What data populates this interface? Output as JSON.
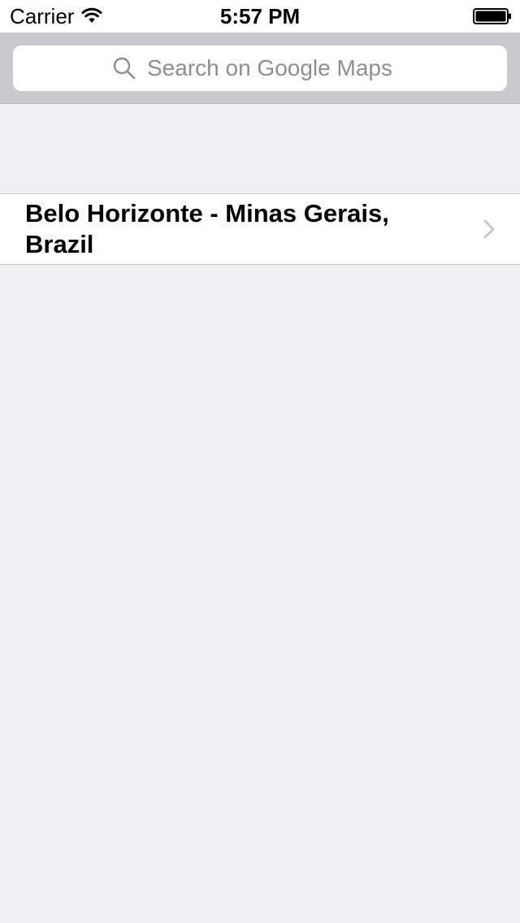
{
  "status_bar": {
    "carrier": "Carrier",
    "time": "5:57 PM",
    "wifi_icon": "wifi-icon",
    "battery_icon": "battery-icon"
  },
  "search": {
    "placeholder": "Search on Google Maps",
    "value": "",
    "icon": "search-icon"
  },
  "results": {
    "items": [
      {
        "label": "Belo Horizonte - Minas Gerais, Brazil",
        "icon": "chevron-right-icon"
      }
    ]
  },
  "colors": {
    "background": "#efeff4",
    "search_bar": "#c9c9ce",
    "placeholder": "#8e8e93",
    "chevron": "#c7c7cc"
  }
}
